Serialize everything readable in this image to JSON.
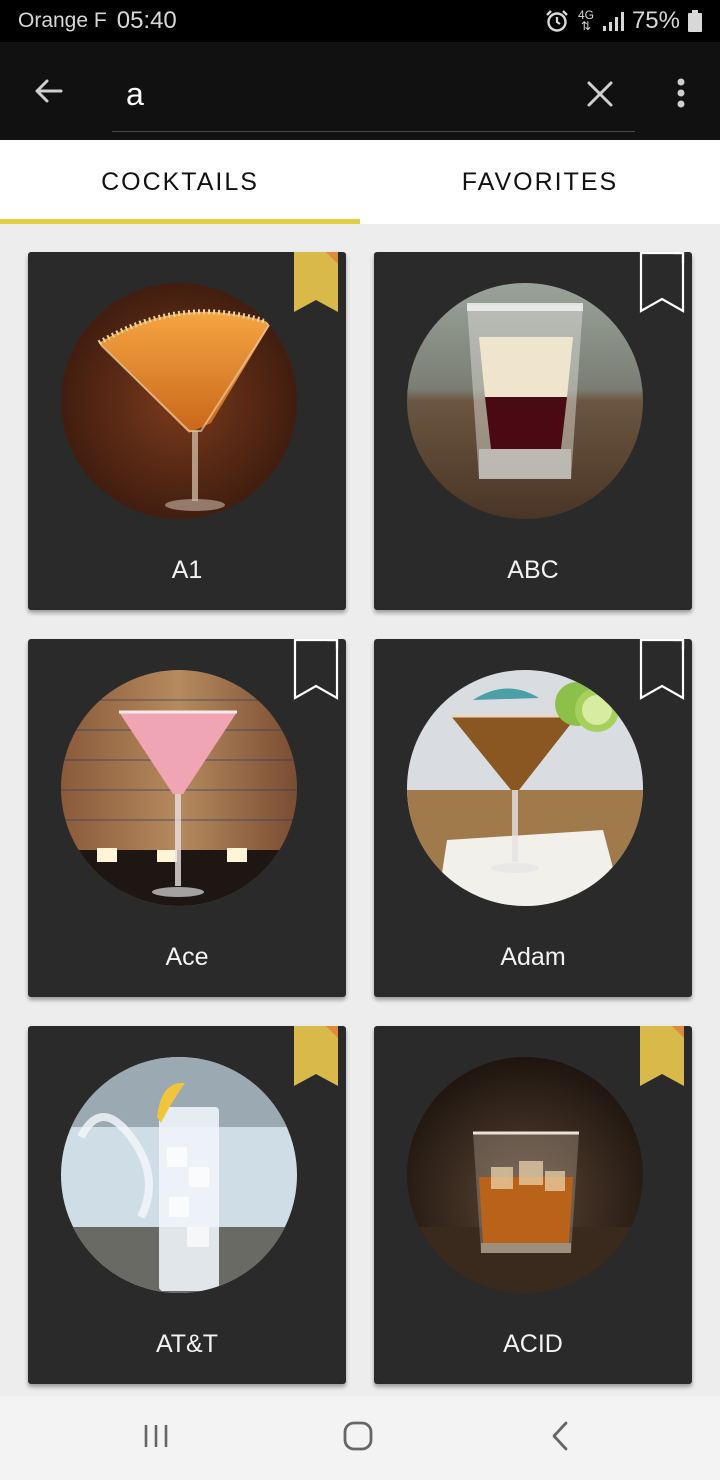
{
  "status_bar": {
    "carrier": "Orange F",
    "time": "05:40",
    "network": "4G",
    "battery": "75%",
    "icons": [
      "alarm-icon",
      "network-4g-icon",
      "signal-icon",
      "battery-icon"
    ]
  },
  "search": {
    "value": "a",
    "icons": [
      "back-arrow-icon",
      "close-icon",
      "more-vert-icon"
    ]
  },
  "tabs": [
    {
      "label": "COCKTAILS",
      "active": true
    },
    {
      "label": "FAVORITES",
      "active": false
    }
  ],
  "colors": {
    "accent": "#e3cd45",
    "bookmark_filled": "#d9b94a",
    "bookmark_corner": "#e08a3c",
    "card_bg": "#2a2a2a",
    "appbar_bg": "#111111"
  },
  "cocktails": [
    {
      "name": "A1",
      "favorite": true
    },
    {
      "name": "ABC",
      "favorite": false
    },
    {
      "name": "Ace",
      "favorite": false
    },
    {
      "name": "Adam",
      "favorite": false
    },
    {
      "name": "AT&T",
      "favorite": true
    },
    {
      "name": "ACID",
      "favorite": true
    }
  ],
  "nav": {
    "icons": [
      "recent-apps-icon",
      "home-icon",
      "nav-back-icon"
    ]
  }
}
